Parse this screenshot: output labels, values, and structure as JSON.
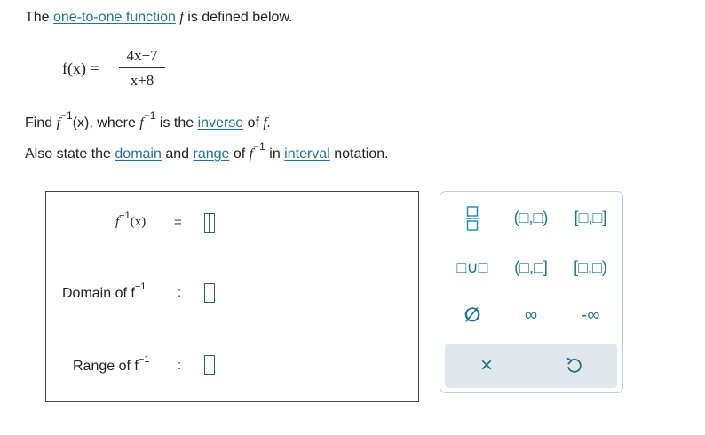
{
  "problem": {
    "intro_the": "The",
    "intro_link": "one-to-one function",
    "intro_f": "f",
    "intro_rest": "is defined below.",
    "fx_label": "f(x) =",
    "numerator": "4x−7",
    "denominator": "x+8",
    "find_text": "Find",
    "find_f": "f",
    "find_sup": "−1",
    "find_arg": "(x), where",
    "where_f": "f",
    "where_sup": "−1",
    "where_rest": "is the",
    "inverse_link": "inverse",
    "of_text": "of",
    "of_f": "f.",
    "also_text": "Also state the",
    "domain_link": "domain",
    "and_text": "and",
    "range_link": "range",
    "of2_text": "of",
    "of2_f": "f",
    "of2_sup": "−1",
    "in_text": "in",
    "interval_link": "interval",
    "notation_text": "notation."
  },
  "answer": {
    "inverse_label_f": "f",
    "inverse_label_sup": "−1",
    "inverse_label_arg": "(x)",
    "equals": "=",
    "domain_label": "Domain of f",
    "domain_sup": "−1",
    "range_label": "Range of f",
    "range_sup": "−1",
    "colon": ":"
  },
  "palette": {
    "open_open": "(□,□)",
    "closed_closed": "[□,□]",
    "union": "□∪□",
    "open_closed": "(□,□]",
    "closed_open": "[□,□)",
    "empty_set": "∅",
    "infinity": "∞",
    "neg_infinity": "-∞",
    "clear": "×",
    "accent": "#1f7590"
  }
}
